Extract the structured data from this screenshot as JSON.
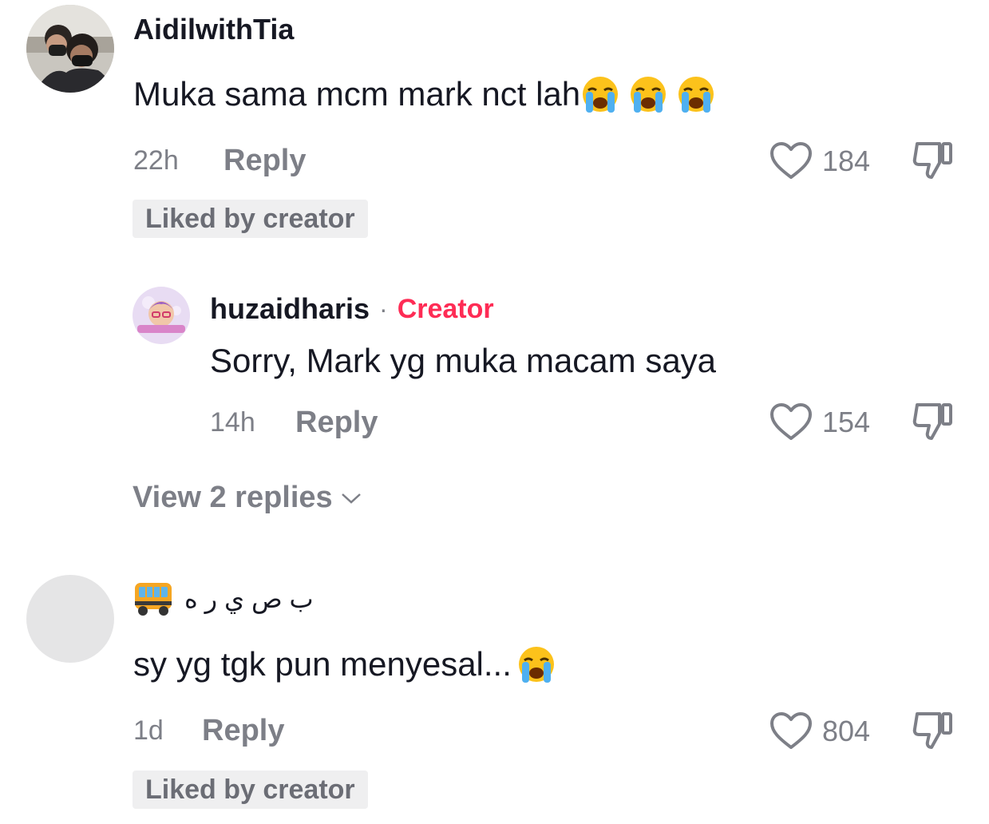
{
  "comments": [
    {
      "username": "AidilwithTia",
      "text": "Muka sama mcm mark nct lah",
      "emojis": [
        "loudly-crying-face",
        "loudly-crying-face",
        "loudly-crying-face"
      ],
      "time": "22h",
      "reply_label": "Reply",
      "likes": "184",
      "badge": "Liked by creator"
    },
    {
      "username": "ب ص ي ر ه",
      "username_emoji": "bus",
      "text": "sy yg tgk pun menyesal...",
      "emojis": [
        "loudly-crying-face"
      ],
      "time": "1d",
      "reply_label": "Reply",
      "likes": "804",
      "badge": "Liked by creator"
    }
  ],
  "reply": {
    "username": "huzaidharis",
    "separator": "·",
    "creator_tag": "Creator",
    "text": "Sorry, Mark yg muka macam saya",
    "time": "14h",
    "reply_label": "Reply",
    "likes": "154"
  },
  "view_replies": "View 2 replies",
  "colors": {
    "accent": "#fe2c55",
    "secondary_text": "#7d7f87",
    "badge_bg": "#efeff0"
  }
}
